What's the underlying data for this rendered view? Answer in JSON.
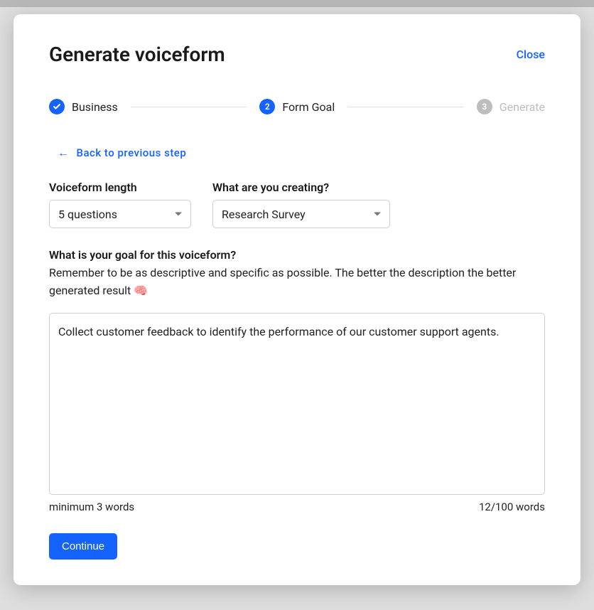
{
  "modal": {
    "title": "Generate voiceform",
    "close_label": "Close"
  },
  "stepper": {
    "steps": [
      {
        "label": "Business",
        "state": "done"
      },
      {
        "label": "Form Goal",
        "state": "active",
        "num": "2"
      },
      {
        "label": "Generate",
        "state": "pending",
        "num": "3"
      }
    ]
  },
  "back_link": {
    "label": "Back to previous step"
  },
  "length_field": {
    "label": "Voiceform length",
    "value": "5 questions"
  },
  "type_field": {
    "label": "What are you creating?",
    "value": "Research Survey"
  },
  "goal": {
    "title": "What is your goal for this voiceform?",
    "description": "Remember to be as descriptive and specific as possible. The better the description the better generated result 🧠",
    "value": "Collect customer feedback to identify the performance of our customer support agents.",
    "min_hint": "minimum 3 words",
    "counter": "12/100 words"
  },
  "continue_label": "Continue"
}
